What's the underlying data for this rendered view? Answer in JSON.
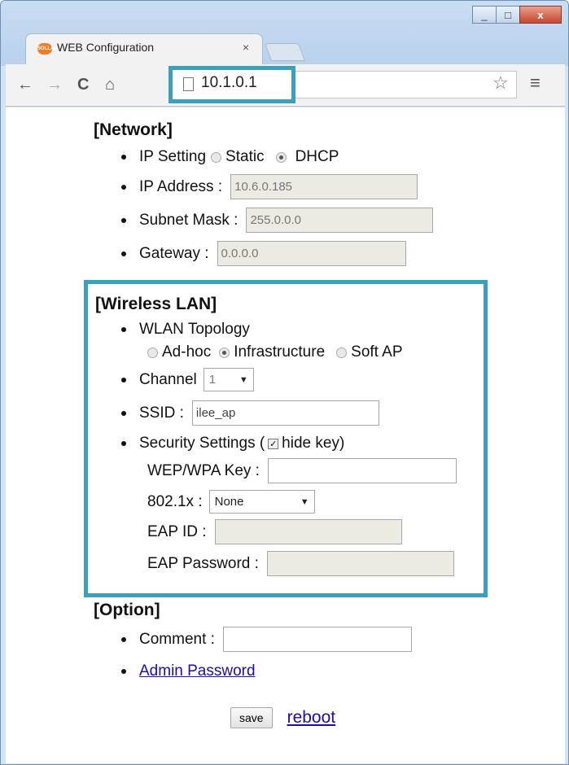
{
  "window": {
    "minimize_icon": "_",
    "maximize_icon": "□",
    "close_icon": "x"
  },
  "tab": {
    "favicon_text": "SOLLAE",
    "title": "WEB Configuration",
    "close": "×"
  },
  "toolbar": {
    "back": "←",
    "forward": "→",
    "reload": "C",
    "home": "⌂",
    "url": "10.1.0.1",
    "star": "☆",
    "menu": "≡"
  },
  "network": {
    "title": "[Network]",
    "ip_setting_label": "IP Setting",
    "static_label": "Static",
    "dhcp_label": "DHCP",
    "ip_address_label": "IP Address :",
    "ip_address_value": "10.6.0.185",
    "subnet_label": "Subnet Mask :",
    "subnet_value": "255.0.0.0",
    "gateway_label": "Gateway :",
    "gateway_value": "0.0.0.0"
  },
  "wireless": {
    "title": "[Wireless LAN]",
    "topology_label": "WLAN Topology",
    "adhoc_label": "Ad-hoc",
    "infra_label": "Infrastructure",
    "softap_label": "Soft AP",
    "channel_label": "Channel",
    "channel_value": "1",
    "ssid_label": "SSID :",
    "ssid_value": "ilee_ap",
    "security_label": "Security Settings (",
    "hide_key_label": "hide key)",
    "wep_label": "WEP/WPA Key :",
    "wep_value": "",
    "dot1x_label": "802.1x :",
    "dot1x_value": "None",
    "eap_id_label": "EAP ID :",
    "eap_id_value": "",
    "eap_pw_label": "EAP Password :",
    "eap_pw_value": ""
  },
  "option": {
    "title": "[Option]",
    "comment_label": "Comment :",
    "comment_value": "",
    "admin_link": "Admin Password"
  },
  "actions": {
    "save": "save",
    "reboot": "reboot"
  },
  "colors": {
    "highlight": "#3aa0bb",
    "link": "#1a0dab"
  }
}
